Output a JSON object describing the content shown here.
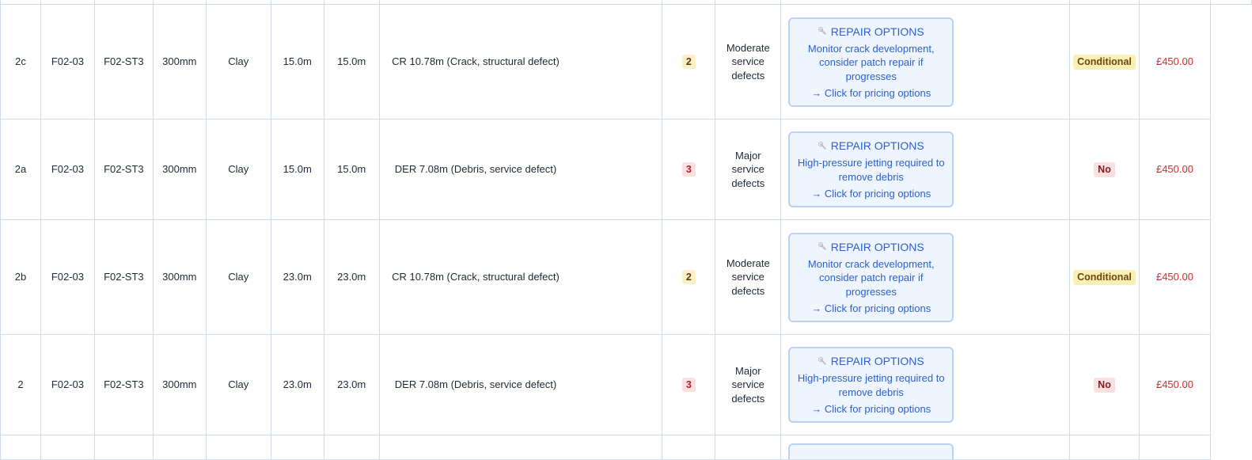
{
  "table": {
    "rows": [
      {
        "item_no": "2c",
        "upstream": "F02-03",
        "downstream": "F02-ST3",
        "diameter": "300mm",
        "material": "Clay",
        "total_length": "15.0m",
        "length_surveyed": "15.0m",
        "defects": "CR 10.78m (Crack, structural defect)",
        "severity": "2",
        "severity_level": "moderate",
        "category": [
          "Moderate",
          "service",
          "defects"
        ],
        "repair": {
          "title": "REPAIR OPTIONS",
          "icon": "wrench-icon",
          "description": "Monitor crack development, consider patch repair if progresses",
          "link": "→ Click for pricing options"
        },
        "adoptable": "Conditional",
        "adoptable_level": "conditional",
        "cost": "£450.00"
      },
      {
        "item_no": "2a",
        "upstream": "F02-03",
        "downstream": "F02-ST3",
        "diameter": "300mm",
        "material": "Clay",
        "total_length": "15.0m",
        "length_surveyed": "15.0m",
        "defects": "DER 7.08m (Debris, service defect)",
        "severity": "3",
        "severity_level": "major",
        "category": [
          "Major",
          "service",
          "defects"
        ],
        "repair": {
          "title": "REPAIR OPTIONS",
          "icon": "wrench-icon",
          "description": "High-pressure jetting required to remove debris",
          "link": "→ Click for pricing options"
        },
        "adoptable": "No",
        "adoptable_level": "no",
        "cost": "£450.00"
      },
      {
        "item_no": "2b",
        "upstream": "F02-03",
        "downstream": "F02-ST3",
        "diameter": "300mm",
        "material": "Clay",
        "total_length": "23.0m",
        "length_surveyed": "23.0m",
        "defects": "CR 10.78m (Crack, structural defect)",
        "severity": "2",
        "severity_level": "moderate",
        "category": [
          "Moderate",
          "service",
          "defects"
        ],
        "repair": {
          "title": "REPAIR OPTIONS",
          "icon": "wrench-icon",
          "description": "Monitor crack development, consider patch repair if progresses",
          "link": "→ Click for pricing options"
        },
        "adoptable": "Conditional",
        "adoptable_level": "conditional",
        "cost": "£450.00"
      },
      {
        "item_no": "2",
        "upstream": "F02-03",
        "downstream": "F02-ST3",
        "diameter": "300mm",
        "material": "Clay",
        "total_length": "23.0m",
        "length_surveyed": "23.0m",
        "defects": "DER 7.08m (Debris, service defect)",
        "severity": "3",
        "severity_level": "major",
        "category": [
          "Major",
          "service",
          "defects"
        ],
        "repair": {
          "title": "REPAIR OPTIONS",
          "icon": "wrench-icon",
          "description": "High-pressure jetting required to remove debris",
          "link": "→ Click for pricing options"
        },
        "adoptable": "No",
        "adoptable_level": "no",
        "cost": "£450.00"
      }
    ]
  },
  "colors": {
    "grid_border": "#cfdbe9",
    "card_background": "#eef5ff",
    "card_border": "#b7d2f3",
    "card_text": "#2c5fd0",
    "severity_moderate_bg": "#fdf0c4",
    "severity_major_bg": "#fbe0e0",
    "adoptable_conditional_bg": "#fbefb8",
    "adoptable_no_bg": "#fbe0e0",
    "cost_text": "#d82a2a"
  }
}
